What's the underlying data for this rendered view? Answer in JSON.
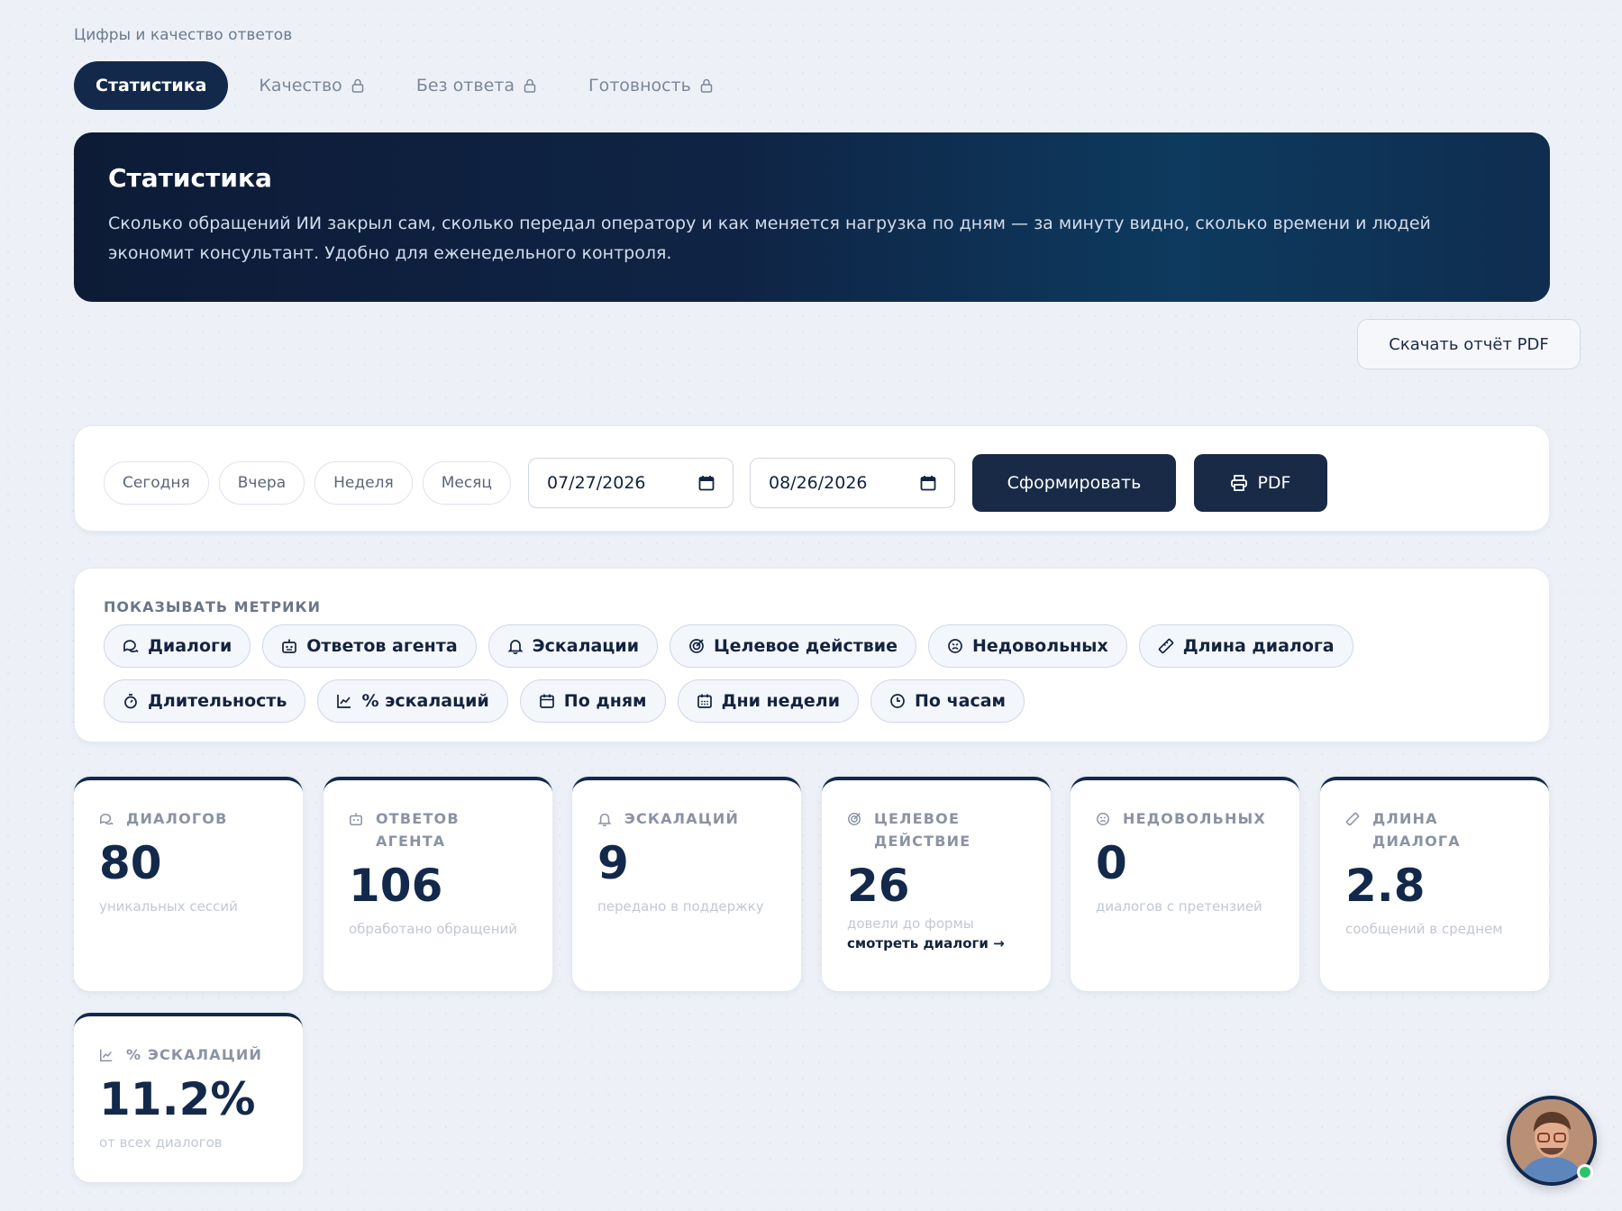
{
  "breadcrumb": "Цифры и качество ответов",
  "tabs": [
    {
      "label": "Статистика",
      "active": true
    },
    {
      "label": "Качество",
      "locked": true
    },
    {
      "label": "Без ответа",
      "locked": true
    },
    {
      "label": "Готовность",
      "locked": true
    }
  ],
  "hero": {
    "title": "Статистика",
    "description": "Сколько обращений ИИ закрыл сам, сколько передал оператору и как меняется нагрузка по дням — за минуту видно, сколько времени и людей экономит консультант. Удобно для еженедельного контроля."
  },
  "download_pdf_label": "Скачать отчёт PDF",
  "filters": {
    "presets": [
      "Сегодня",
      "Вчера",
      "Неделя",
      "Месяц"
    ],
    "date_from": "07/27/2026",
    "date_to": "08/26/2026",
    "generate_label": "Сформировать",
    "pdf_label": "PDF"
  },
  "metrics_selector": {
    "label": "ПОКАЗЫВАТЬ МЕТРИКИ",
    "chips": [
      {
        "label": "Диалоги",
        "icon": "chat-icon"
      },
      {
        "label": "Ответов агента",
        "icon": "robot-icon"
      },
      {
        "label": "Эскалации",
        "icon": "bell-icon"
      },
      {
        "label": "Целевое действие",
        "icon": "target-icon"
      },
      {
        "label": "Недовольных",
        "icon": "frown-icon"
      },
      {
        "label": "Длина диалога",
        "icon": "ruler-icon"
      },
      {
        "label": "Длительность",
        "icon": "stopwatch-icon"
      },
      {
        "label": "% эскалаций",
        "icon": "trend-icon"
      },
      {
        "label": "По дням",
        "icon": "calendar-icon"
      },
      {
        "label": "Дни недели",
        "icon": "calendar-grid-icon"
      },
      {
        "label": "По часам",
        "icon": "clock-icon"
      }
    ]
  },
  "kpis": [
    {
      "title": "ДИАЛОГОВ",
      "value": "80",
      "sub": "уникальных сессий",
      "icon": "chat-icon"
    },
    {
      "title": "ОТВЕТОВ АГЕНТА",
      "value": "106",
      "sub": "обработано обращений",
      "icon": "robot-icon"
    },
    {
      "title": "ЭСКАЛАЦИЙ",
      "value": "9",
      "sub": "передано в поддержку",
      "icon": "bell-icon"
    },
    {
      "title": "ЦЕЛЕВОЕ ДЕЙСТВИЕ",
      "value": "26",
      "sub": "довели до формы",
      "link": "смотреть диалоги →",
      "icon": "target-icon"
    },
    {
      "title": "НЕДОВОЛЬНЫХ",
      "value": "0",
      "sub": "диалогов с претензией",
      "icon": "frown-icon"
    },
    {
      "title": "ДЛИНА ДИАЛОГА",
      "value": "2.8",
      "sub": "сообщений в среднем",
      "icon": "ruler-icon"
    },
    {
      "title": "% ЭСКАЛАЦИЙ",
      "value": "11.2%",
      "sub": "от всех диалогов",
      "icon": "trend-icon"
    }
  ],
  "colors": {
    "accent": "#13294b",
    "online": "#2cc36b"
  }
}
